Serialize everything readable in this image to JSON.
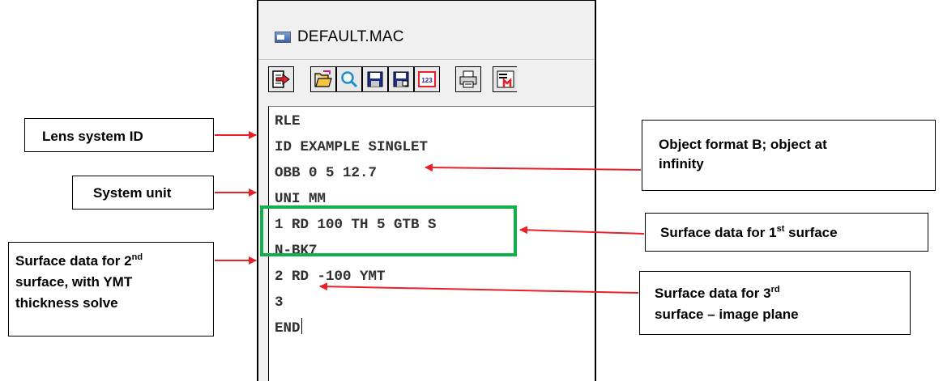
{
  "window": {
    "title": "DEFAULT.MAC"
  },
  "toolbar": {
    "buttons": [
      {
        "icon": "execute-arrow-icon"
      },
      {
        "icon": "open-folder-icon"
      },
      {
        "icon": "search-icon"
      },
      {
        "icon": "save-icon"
      },
      {
        "icon": "save-as-icon"
      },
      {
        "icon": "line-numbers-icon",
        "label": "123"
      },
      {
        "icon": "print-icon"
      },
      {
        "icon": "macro-icon"
      }
    ]
  },
  "editor": {
    "lines": [
      "RLE",
      "ID EXAMPLE SINGLET",
      "OBB 0 5 12.7",
      "UNI MM",
      "1 RD 100 TH 5 GTB S",
      "N-BK7",
      "2 RD -100 YMT",
      "3",
      "END"
    ]
  },
  "annotations": {
    "lens_id": "Lens system ID",
    "system_unit": "System unit",
    "surface2": {
      "prefix": "Surface data for 2",
      "sup": "nd",
      "rest_line1": "",
      "line2": "surface, with YMT",
      "line3": "thickness solve"
    },
    "object_format": {
      "line1": "Object format B; object at",
      "line2": "infinity"
    },
    "surface1": {
      "prefix": "Surface data for 1",
      "sup": "st",
      "suffix": " surface"
    },
    "surface3": {
      "prefix": "Surface data for 3",
      "sup": "rd",
      "line2": "surface – image plane"
    }
  },
  "colors": {
    "arrow": "#e8202a",
    "highlight_box": "#12b04a",
    "code_text": "#303030"
  }
}
